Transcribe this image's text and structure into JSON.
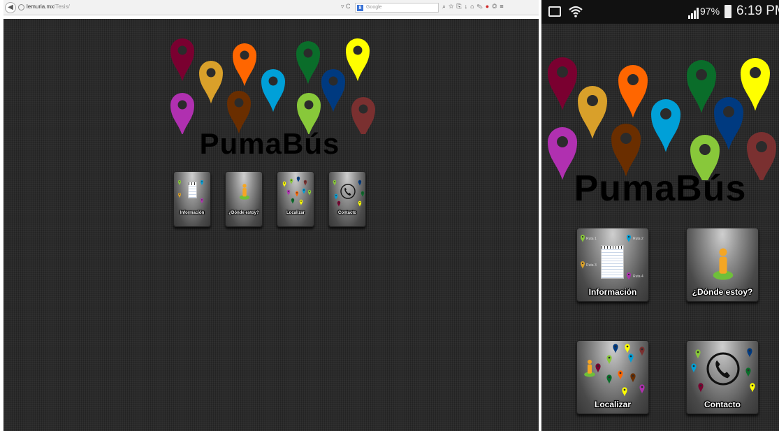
{
  "browser": {
    "url_host": "lemuria.mx",
    "url_path": "/Tesis/",
    "search_engine": "8",
    "search_placeholder": "Google",
    "reload_glyph": "▿ C"
  },
  "phone_status": {
    "battery": "97%",
    "time": "6:19 PM"
  },
  "app": {
    "name": "PumaBús",
    "pin_colors": [
      "#7a0030",
      "#d9a02a",
      "#ff6600",
      "#00a0d8",
      "#0a6d2a",
      "#ffff00",
      "#003a80",
      "#6a2e00",
      "#b030b0",
      "#88c83a",
      "#7a3030"
    ]
  },
  "menu": {
    "tiles": [
      {
        "label": "Información",
        "icon": "notepad-icon"
      },
      {
        "label": "¿Dónde estoy?",
        "icon": "person-pin-icon"
      },
      {
        "label": "Localizar",
        "icon": "pins-cluster-icon"
      },
      {
        "label": "Contacto",
        "icon": "phone-icon"
      }
    ],
    "route_labels": [
      "Ruta 1",
      "Ruta 2",
      "Ruta 3",
      "Ruta 4"
    ]
  }
}
